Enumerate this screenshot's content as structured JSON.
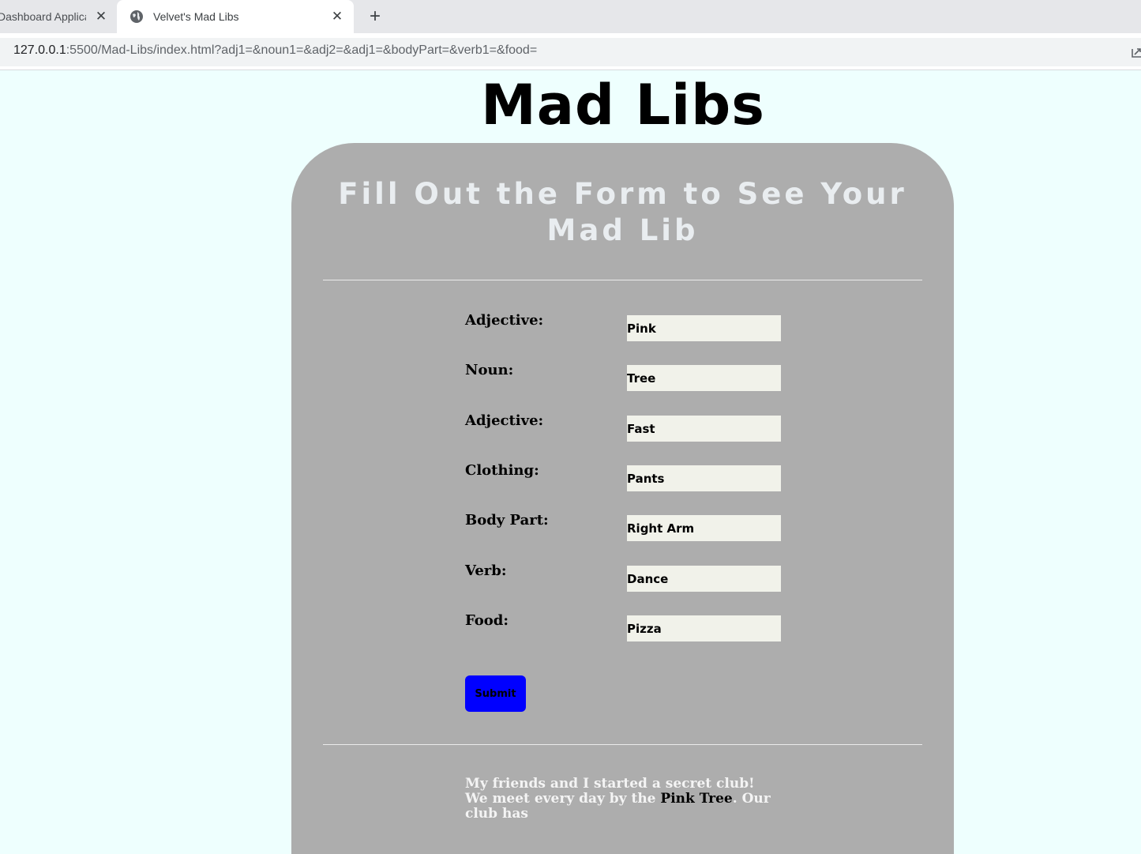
{
  "browser": {
    "tabs": [
      {
        "title": "Dashboard Application",
        "active": false
      },
      {
        "title": "Velvet's Mad Libs",
        "active": true
      }
    ],
    "tab_close_glyph": "✕",
    "new_tab_glyph": "+",
    "url_host": "127.0.0.1",
    "url_rest": ":5500/Mad-Libs/index.html?adj1=&noun1=&adj2=&adj1=&bodyPart=&verb1=&food="
  },
  "page": {
    "title": "Mad Libs",
    "card_heading": "Fill Out the Form to See Your Mad Lib",
    "fields": [
      {
        "label": "Adjective:",
        "value": "Pink"
      },
      {
        "label": "Noun:",
        "value": "Tree"
      },
      {
        "label": "Adjective:",
        "value": "Fast"
      },
      {
        "label": "Clothing:",
        "value": "Pants"
      },
      {
        "label": "Body Part:",
        "value": "Right Arm"
      },
      {
        "label": "Verb:",
        "value": "Dance"
      },
      {
        "label": "Food:",
        "value": "Pizza"
      }
    ],
    "submit_label": "Submit",
    "story": {
      "part1": "My friends and I started a secret club! We meet every day by the ",
      "highlight1": "Pink Tree",
      "part2": ". Our club has"
    }
  },
  "colors": {
    "page_bg": "#eefffe",
    "card_bg": "#adadad",
    "submit_bg": "#0000ff",
    "input_bg": "#f1f2ea",
    "heading_text": "#e9edf0"
  },
  "icons": {
    "tab_favicon": "globe-icon",
    "close": "close-icon",
    "new_tab": "plus-icon",
    "share": "share-icon"
  }
}
